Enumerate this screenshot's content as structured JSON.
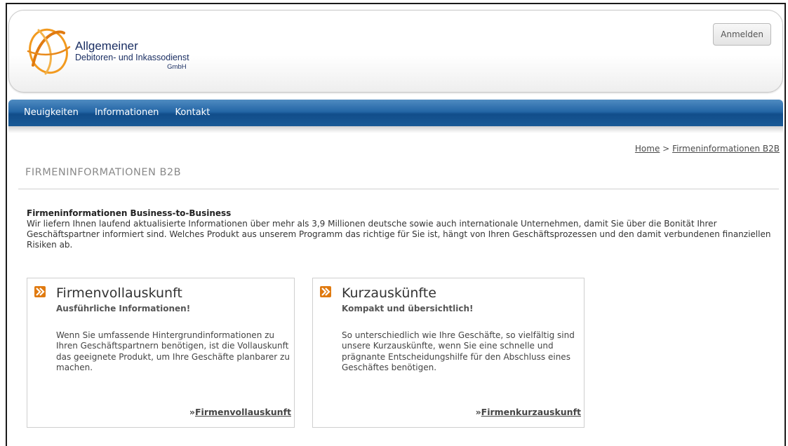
{
  "header": {
    "logo_line1": "Allgemeiner",
    "logo_line2": "Debitoren- und Inkassodienst",
    "logo_line3": "GmbH",
    "login_label": "Anmelden"
  },
  "nav": {
    "items": [
      {
        "label": "Neuigkeiten"
      },
      {
        "label": "Informationen"
      },
      {
        "label": "Kontakt"
      }
    ]
  },
  "breadcrumb": {
    "home": "Home",
    "separator": ">",
    "current": "Firmeninformationen B2B"
  },
  "page": {
    "title": "FIRMENINFORMATIONEN B2B",
    "intro_heading": "Firmeninformationen Business-to-Business",
    "intro_text": "Wir liefern Ihnen laufend aktualisierte Informationen über mehr als 3,9 Millionen deutsche sowie auch internationale Unternehmen, damit Sie über die Bonität Ihrer Geschäftspartner informiert sind. Welches Produkt aus unserem Programm das richtige für Sie ist, hängt von Ihren Geschäftsprozessen und den damit verbundenen finanziellen Risiken ab."
  },
  "cards": [
    {
      "title": "Firmenvollauskunft",
      "subtitle": "Ausführliche Informationen!",
      "body": "Wenn Sie umfassende Hintergrundinformationen zu Ihren Geschäftspartnern benötigen, ist die Vollauskunft das geeignete Produkt, um Ihre Geschäfte planbarer zu machen.",
      "link_prefix": "»",
      "link_label": "Firmenvollauskunft"
    },
    {
      "title": "Kurzauskünfte",
      "subtitle": "Kompakt und übersichtlich!",
      "body": "So unterschiedlich wie Ihre Geschäfte, so vielfältig sind unsere Kurzauskünfte, wenn Sie eine schnelle und prägnante Entscheidungshilfe für den Abschluss eines Geschäftes benötigen.",
      "link_prefix": "»",
      "link_label": "Firmenkurzauskunft"
    }
  ],
  "colors": {
    "brand_orange": "#e07a10",
    "brand_navy": "#1b2f63",
    "nav_blue": "#2466a6"
  },
  "icons": {
    "logo": "orbit-logo-icon",
    "card_bullet": "double-chevron-right-icon"
  }
}
